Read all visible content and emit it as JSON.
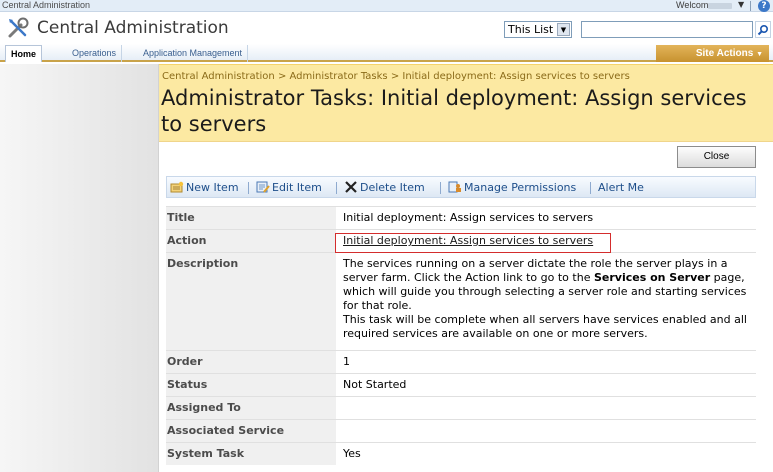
{
  "topbar": {
    "site_name": "Central Administration",
    "welcome": "Welcome"
  },
  "header": {
    "app_title": "Central Administration",
    "search_scope": "This List",
    "search_value": ""
  },
  "nav": {
    "tabs": [
      "Home",
      "Operations",
      "Application Management"
    ],
    "site_actions": "Site Actions"
  },
  "page": {
    "breadcrumb": "Central Administration > Administrator Tasks > Initial deployment: Assign services to servers",
    "title": "Administrator Tasks: Initial deployment: Assign services to servers"
  },
  "toolbar": {
    "close": "Close",
    "new_item": "New Item",
    "edit_item": "Edit Item",
    "delete_item": "Delete Item",
    "manage_permissions": "Manage Permissions",
    "alert_me": "Alert Me"
  },
  "fields": {
    "title_label": "Title",
    "title_value": "Initial deployment: Assign services to servers",
    "action_label": "Action",
    "action_value": "Initial deployment: Assign services to servers",
    "description_label": "Description",
    "description_p1": "The services running on a server dictate the role the server plays in a server farm. Click the Action link to go to the",
    "description_bold": "Services on Server",
    "description_p2": "page, which will guide you through selecting a server role and starting services for that role.",
    "description_p3": "This task will be complete when all servers have services enabled and all required services are available on one or more servers.",
    "order_label": "Order",
    "order_value": "1",
    "status_label": "Status",
    "status_value": "Not Started",
    "assigned_label": "Assigned To",
    "assigned_value": "",
    "associated_label": "Associated Service",
    "associated_value": "",
    "system_label": "System Task",
    "system_value": "Yes"
  },
  "icons": {
    "logo": "tools-icon",
    "search_go": "search-icon",
    "new_item": "new-item-icon",
    "edit_item": "edit-icon",
    "delete_item": "delete-x-icon",
    "manage_permissions": "permissions-icon",
    "help": "help-icon"
  },
  "colors": {
    "title_band": "#fce9a2",
    "site_actions": "#d4a441",
    "highlight_box": "#d42d2d"
  }
}
